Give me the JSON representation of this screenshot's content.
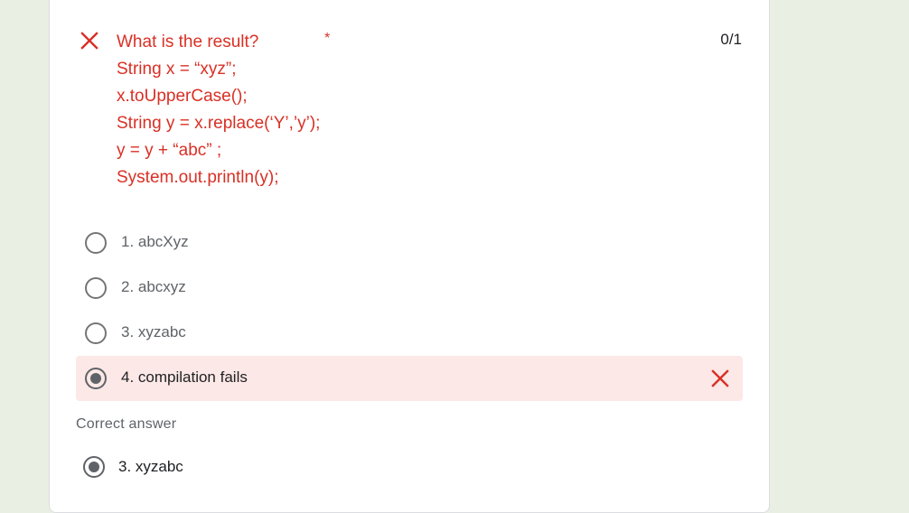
{
  "question": {
    "lines": [
      "What is the result?",
      "String x = “xyz”;",
      "x.toUpperCase();",
      "String y = x.replace(‘Y’,’y’);",
      "y = y + “abc” ;",
      "System.out.println(y);"
    ],
    "required_marker": "*",
    "score": "0/1",
    "status_icon": "close-icon",
    "status_color": "#d93025"
  },
  "options": [
    {
      "label": "1. abcXyz",
      "selected": false
    },
    {
      "label": "2. abcxyz",
      "selected": false
    },
    {
      "label": "3. xyzabc",
      "selected": false
    },
    {
      "label": "4. compilation fails",
      "selected": true,
      "result": "incorrect"
    }
  ],
  "correct_answer": {
    "heading": "Correct answer",
    "label": "3. xyzabc"
  },
  "colors": {
    "error": "#d93025",
    "wrong_bg": "#fce8e6",
    "page_bg": "#eaefe3"
  }
}
